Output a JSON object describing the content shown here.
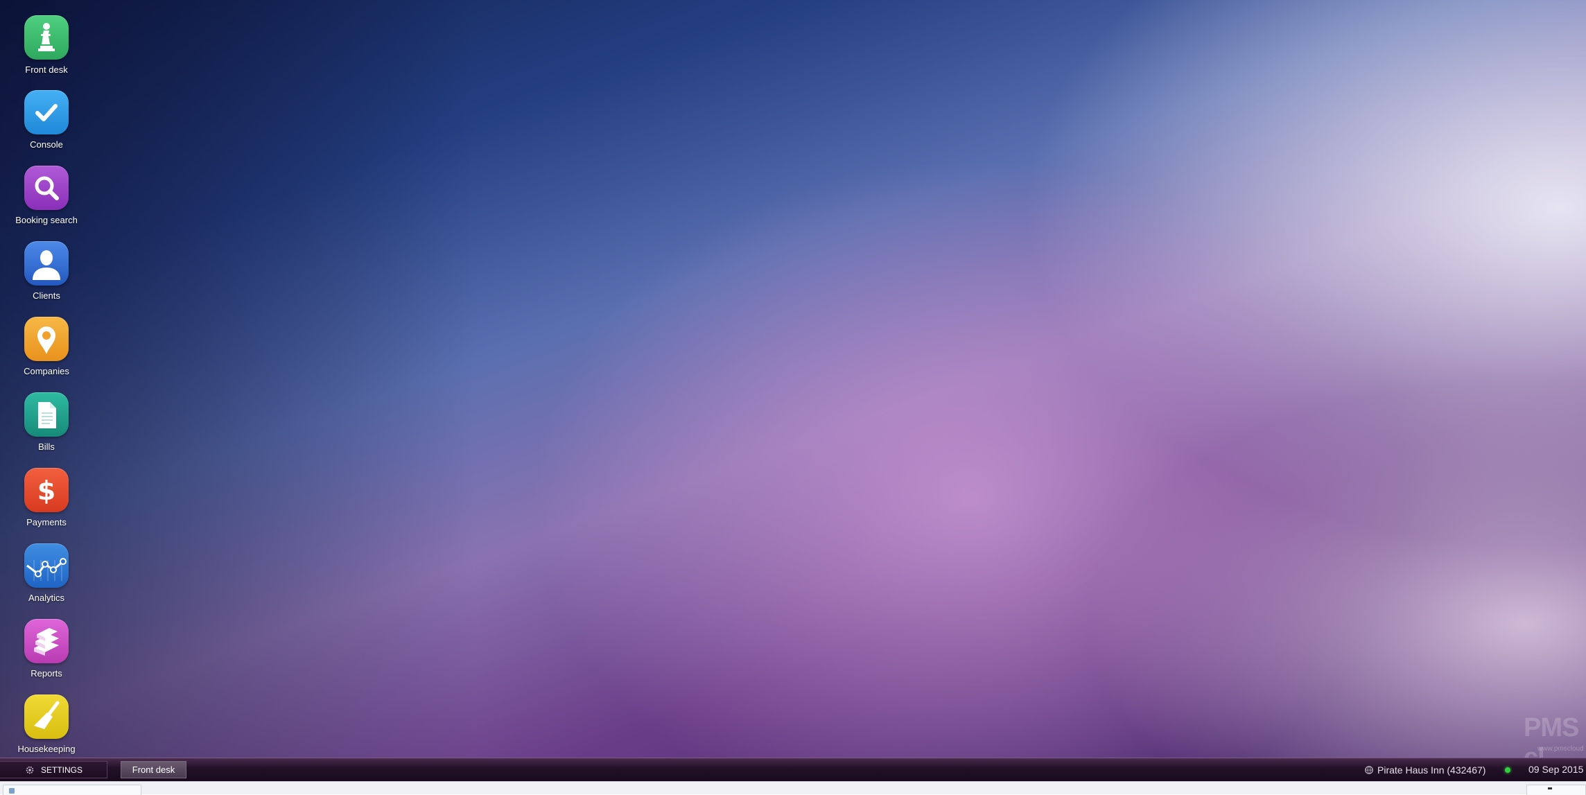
{
  "apps": [
    {
      "label": "Front desk",
      "icon": "pawn-icon",
      "color": "#35b86a"
    },
    {
      "label": "Console",
      "icon": "checkmark-icon",
      "color": "#2a9be8"
    },
    {
      "label": "Booking search",
      "icon": "magnifier-icon",
      "color": "#9b3fc8"
    },
    {
      "label": "Clients",
      "icon": "person-icon",
      "color": "#2f6fd6"
    },
    {
      "label": "Companies",
      "icon": "location-pin-icon",
      "color": "#f2a52a"
    },
    {
      "label": "Bills",
      "icon": "document-icon",
      "color": "#1fa38e"
    },
    {
      "label": "Payments",
      "icon": "dollar-icon",
      "color": "#e8452a"
    },
    {
      "label": "Analytics",
      "icon": "line-chart-icon",
      "color": "#2b7ad6"
    },
    {
      "label": "Reports",
      "icon": "books-icon",
      "color": "#d04fc8"
    },
    {
      "label": "Housekeeping",
      "icon": "broom-icon",
      "color": "#e8d01c"
    }
  ],
  "taskbar": {
    "settings_label": "SETTINGS",
    "active_task": "Front desk",
    "hotel": "Pirate Haus Inn (432467)",
    "connection_status_color": "#2fd23a",
    "date": "09 Sep 2015"
  },
  "watermark": {
    "brand": "PMS cl",
    "url": "www.pmscloud"
  }
}
